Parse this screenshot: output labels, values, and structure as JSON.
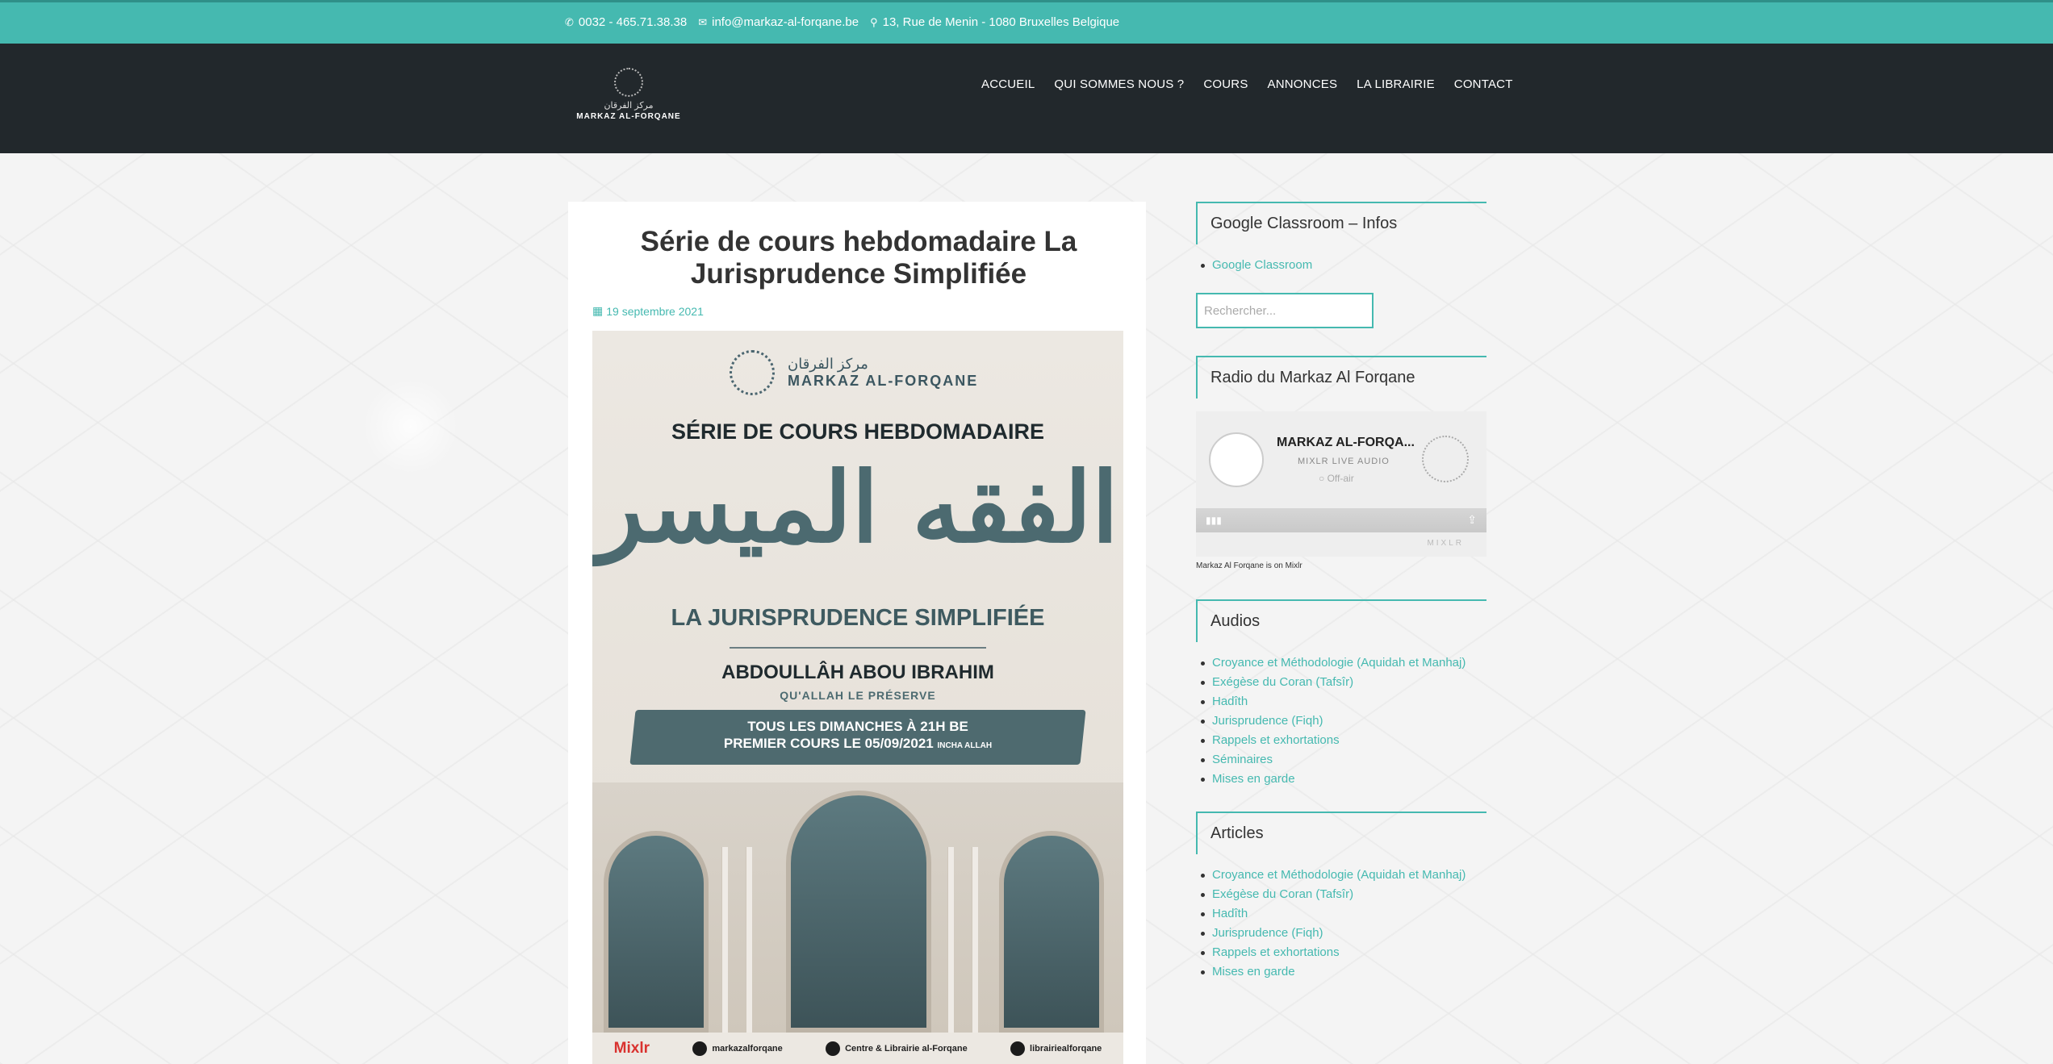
{
  "topbar": {
    "phone": "0032 - 465.71.38.38",
    "email": "info@markaz-al-forqane.be",
    "address": "13, Rue de Menin - 1080 Bruxelles Belgique"
  },
  "logo": {
    "arabic": "مركز الفرقان",
    "name": "MARKAZ AL-FORQANE"
  },
  "nav": {
    "items": [
      "ACCUEIL",
      "QUI SOMMES NOUS ?",
      "COURS",
      "ANNONCES",
      "LA LIBRAIRIE",
      "CONTACT"
    ]
  },
  "post": {
    "title": "Série de cours hebdomadaire La Jurisprudence Simplifiée",
    "date": "19 septembre 2021",
    "poster": {
      "logo_arabic": "مركز الفرقان",
      "logo_name": "MARKAZ AL-FORQANE",
      "series": "SÉRIE DE COURS HEBDOMADAIRE",
      "arabic_title": "الفقه الميسر",
      "subtitle": "LA JURISPRUDENCE SIMPLIFIÉE",
      "speaker": "ABDOULLÂH ABOU IBRAHIM",
      "blessing": "QU'ALLAH LE PRÉSERVE",
      "when_line1": "TOUS LES DIMANCHES À 21H BE",
      "when_line2": "PREMIER COURS LE 05/09/2021",
      "when_note": "INCHA ALLAH",
      "footer_mixlr": "Mixlr",
      "footer_twitter": "markazalforqane",
      "footer_telegram": "Centre & Librairie al-Forqane",
      "footer_facebook": "librairiealforqane"
    }
  },
  "sidebar": {
    "classroom": {
      "title": "Google Classroom – Infos",
      "items": [
        "Google Classroom"
      ]
    },
    "search": {
      "placeholder": "Rechercher..."
    },
    "radio": {
      "title": "Radio du Markaz Al Forqane",
      "player_title": "MARKAZ AL-FORQA...",
      "player_sub": "MIXLR LIVE AUDIO",
      "player_status": "Off-air",
      "player_brand": "MIXLR",
      "caption": "Markaz Al Forqane is on Mixlr"
    },
    "audios": {
      "title": "Audios",
      "items": [
        "Croyance et Méthodologie (Aquidah et Manhaj)",
        "Exégèse du Coran (Tafsîr)",
        "Hadîth",
        "Jurisprudence (Fiqh)",
        "Rappels et exhortations",
        "Séminaires",
        "Mises en garde"
      ]
    },
    "articles": {
      "title": "Articles",
      "items": [
        "Croyance et Méthodologie (Aquidah et Manhaj)",
        "Exégèse du Coran (Tafsîr)",
        "Hadîth",
        "Jurisprudence (Fiqh)",
        "Rappels et exhortations",
        "Mises en garde"
      ]
    }
  }
}
